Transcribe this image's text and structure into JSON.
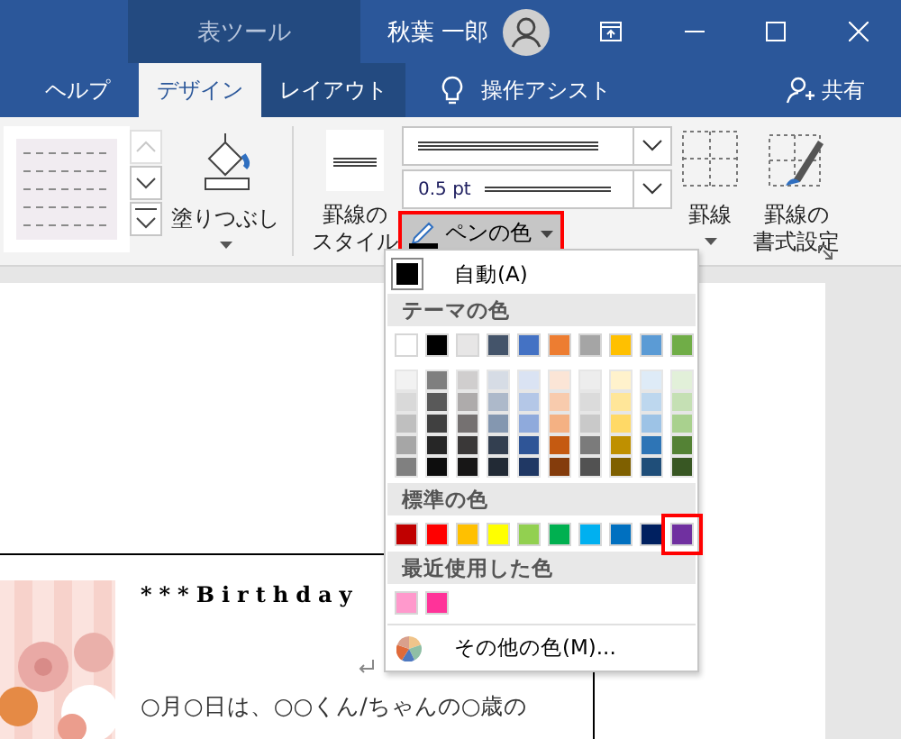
{
  "title_bar": {
    "context_tab": "表ツール",
    "user": "秋葉 一郎"
  },
  "tabs": [
    {
      "label": "ヘルプ",
      "selected": false,
      "kind": "plain"
    },
    {
      "label": "デザイン",
      "selected": true,
      "kind": "context"
    },
    {
      "label": "レイアウト",
      "selected": false,
      "kind": "context"
    }
  ],
  "tell_me": "操作アシスト",
  "share": "共有",
  "ribbon": {
    "fill": "塗りつぶし",
    "border_style": [
      "罫線の",
      "スタイル"
    ],
    "weight": "0.5 pt",
    "pen_color": {
      "label": "ペンの色",
      "marked": true
    },
    "borders": "罫線",
    "border_painter": [
      "罫線の",
      "書式設定"
    ]
  },
  "color_menu": {
    "automatic": "自動(A)",
    "theme_heading": "テーマの色",
    "theme_colors": [
      {
        "color": "#ffffff",
        "shades": [
          {
            "color": "#f2f2f2"
          },
          {
            "color": "#d9d9d9"
          },
          {
            "color": "#bfbfbf"
          },
          {
            "color": "#a6a6a6"
          },
          {
            "color": "#808080"
          }
        ]
      },
      {
        "color": "#000000",
        "shades": [
          {
            "color": "#7f7f7f"
          },
          {
            "color": "#595959"
          },
          {
            "color": "#404040"
          },
          {
            "color": "#262626"
          },
          {
            "color": "#0d0d0d"
          }
        ]
      },
      {
        "color": "#e7e6e6",
        "shades": [
          {
            "color": "#d0cece"
          },
          {
            "color": "#aeabab"
          },
          {
            "color": "#757171"
          },
          {
            "color": "#3a3838"
          },
          {
            "color": "#171616"
          }
        ]
      },
      {
        "color": "#44546a",
        "shades": [
          {
            "color": "#d6dce5"
          },
          {
            "color": "#adb9ca"
          },
          {
            "color": "#8497b0"
          },
          {
            "color": "#333f50"
          },
          {
            "color": "#222a35"
          }
        ]
      },
      {
        "color": "#4472c4",
        "shades": [
          {
            "color": "#dae3f3"
          },
          {
            "color": "#b4c7e7"
          },
          {
            "color": "#8faadc"
          },
          {
            "color": "#2f5597"
          },
          {
            "color": "#203864"
          }
        ]
      },
      {
        "color": "#ed7d31",
        "shades": [
          {
            "color": "#fbe5d6"
          },
          {
            "color": "#f8cbad"
          },
          {
            "color": "#f4b183"
          },
          {
            "color": "#c55a11"
          },
          {
            "color": "#843c0c"
          }
        ]
      },
      {
        "color": "#a5a5a5",
        "shades": [
          {
            "color": "#ededed"
          },
          {
            "color": "#dbdbdb"
          },
          {
            "color": "#c9c9c9"
          },
          {
            "color": "#7b7b7b"
          },
          {
            "color": "#525252"
          }
        ]
      },
      {
        "color": "#ffc000",
        "shades": [
          {
            "color": "#fff2cc"
          },
          {
            "color": "#ffe699"
          },
          {
            "color": "#ffd966"
          },
          {
            "color": "#bf9000"
          },
          {
            "color": "#7f6000"
          }
        ]
      },
      {
        "color": "#5b9bd5",
        "shades": [
          {
            "color": "#deebf7"
          },
          {
            "color": "#bdd7ee"
          },
          {
            "color": "#9dc3e6"
          },
          {
            "color": "#2e75b6"
          },
          {
            "color": "#1f4e79"
          }
        ]
      },
      {
        "color": "#70ad47",
        "shades": [
          {
            "color": "#e2f0d9"
          },
          {
            "color": "#c5e0b4"
          },
          {
            "color": "#a9d18e"
          },
          {
            "color": "#548235"
          },
          {
            "color": "#385723"
          }
        ]
      }
    ],
    "standard_heading": "標準の色",
    "standard_colors": [
      {
        "color": "#c00000",
        "selected": false
      },
      {
        "color": "#ff0000",
        "selected": false
      },
      {
        "color": "#ffc000",
        "selected": false
      },
      {
        "color": "#ffff00",
        "selected": false
      },
      {
        "color": "#92d050",
        "selected": false
      },
      {
        "color": "#00b050",
        "selected": false
      },
      {
        "color": "#00b0f0",
        "selected": false
      },
      {
        "color": "#0070c0",
        "selected": false
      },
      {
        "color": "#002060",
        "selected": false
      },
      {
        "color": "#7030a0",
        "selected": true
      }
    ],
    "recent_heading": "最近使用した色",
    "recent_colors": [
      {
        "color": "#ff99cc"
      },
      {
        "color": "#ff3399"
      }
    ],
    "more_colors": "その他の色(M)..."
  },
  "document": {
    "heading": "***Birthday",
    "line": "○月○日は、○○くん/ちゃんの○歳の"
  }
}
